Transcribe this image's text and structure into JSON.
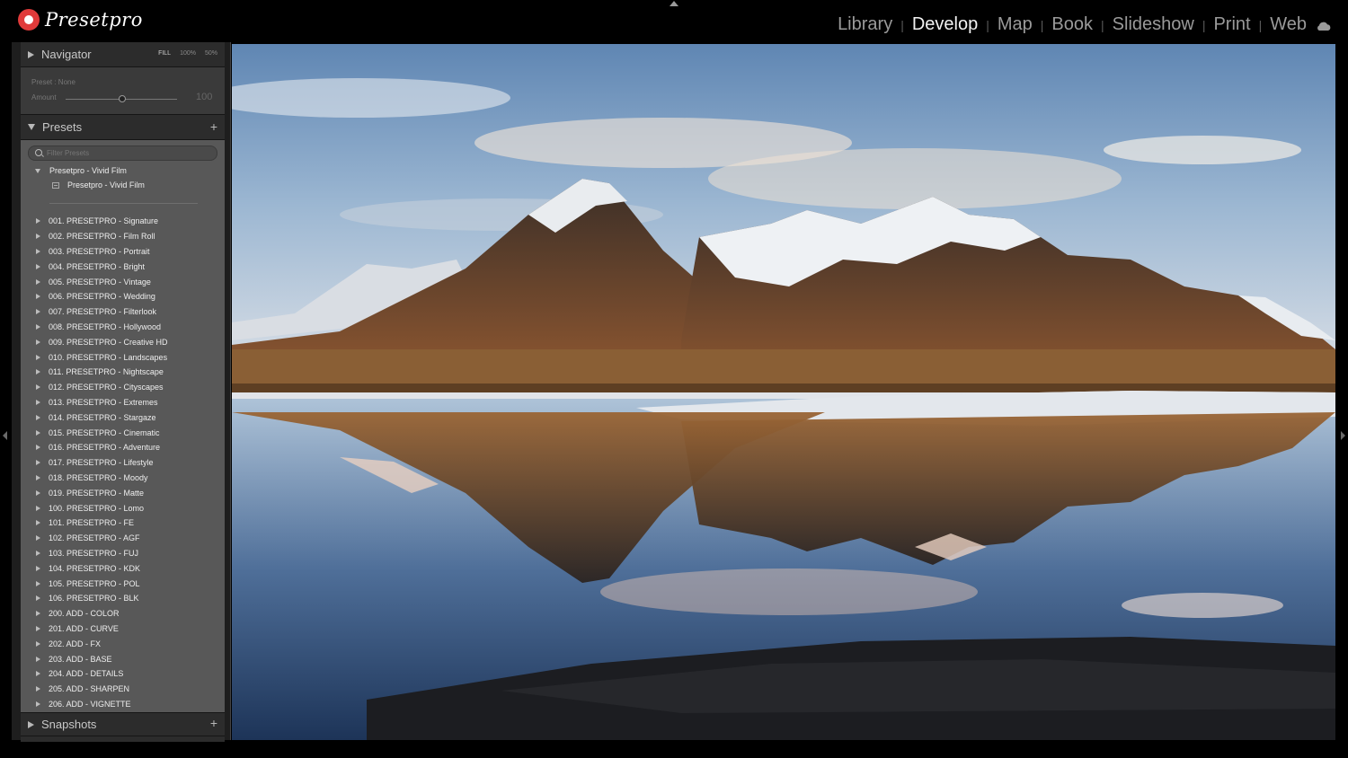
{
  "app": {
    "brand": "Presetpro",
    "brand_color": "#e03a3a"
  },
  "modules": [
    {
      "label": "Library",
      "active": false
    },
    {
      "label": "Develop",
      "active": true
    },
    {
      "label": "Map",
      "active": false
    },
    {
      "label": "Book",
      "active": false
    },
    {
      "label": "Slideshow",
      "active": false
    },
    {
      "label": "Print",
      "active": false
    },
    {
      "label": "Web",
      "active": false
    }
  ],
  "navigator": {
    "title": "Navigator",
    "options": [
      "FILL",
      "100%",
      "50%"
    ]
  },
  "amount": {
    "preset_label": "Preset : None",
    "amount_label": "Amount",
    "value": "100"
  },
  "presets": {
    "title": "Presets",
    "filter_placeholder": "Filter Presets",
    "open_folder": "Presetpro - Vivid Film",
    "open_item": "Presetpro - Vivid Film",
    "folders": [
      "001. PRESETPRO - Signature",
      "002. PRESETPRO - Film Roll",
      "003. PRESETPRO - Portrait",
      "004. PRESETPRO - Bright",
      "005. PRESETPRO - Vintage",
      "006. PRESETPRO - Wedding",
      "007. PRESETPRO - Filterlook",
      "008. PRESETPRO - Hollywood",
      "009. PRESETPRO - Creative HD",
      "010. PRESETPRO - Landscapes",
      "011. PRESETPRO - Nightscape",
      "012. PRESETPRO - Cityscapes",
      "013. PRESETPRO - Extremes",
      "014. PRESETPRO - Stargaze",
      "015. PRESETPRO - Cinematic",
      "016. PRESETPRO - Adventure",
      "017. PRESETPRO - Lifestyle",
      "018. PRESETPRO - Moody",
      "019. PRESETPRO - Matte",
      "100. PRESETPRO - Lomo",
      "101. PRESETPRO - FE",
      "102. PRESETPRO - AGF",
      "103. PRESETPRO - FUJ",
      "104. PRESETPRO - KDK",
      "105. PRESETPRO - POL",
      "106. PRESETPRO - BLK",
      "200. ADD - COLOR",
      "201. ADD - CURVE",
      "202. ADD - FX",
      "203. ADD - BASE",
      "204. ADD - DETAILS",
      "205. ADD - SHARPEN",
      "206. ADD - VIGNETTE"
    ]
  },
  "snapshots": {
    "title": "Snapshots"
  },
  "icons": {
    "cloud": "cloud-sync-icon",
    "add": "plus-icon",
    "search": "search-icon"
  }
}
